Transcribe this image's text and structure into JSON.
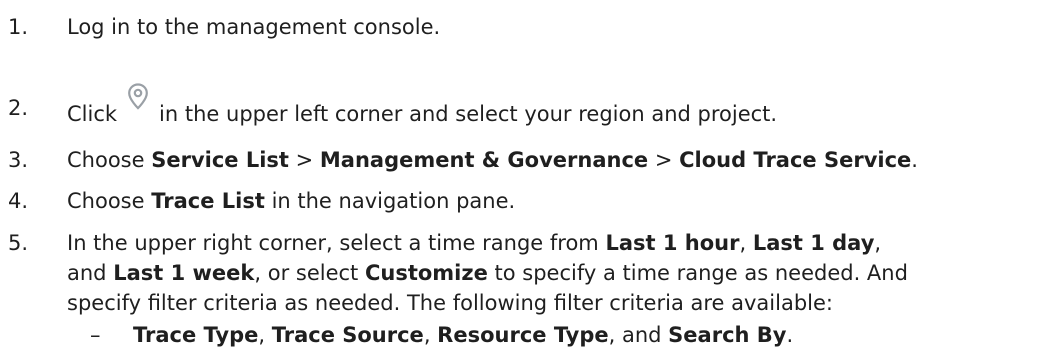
{
  "steps": [
    {
      "num": "1.",
      "text": "Log in to the management console."
    },
    {
      "num": "2.",
      "pre": "Click",
      "icon": "location-pin-icon",
      "post": "in the upper left corner and select your region and project."
    },
    {
      "num": "3.",
      "t1": "Choose ",
      "b1": "Service List",
      "t2": " > ",
      "b2": "Management & Governance",
      "t3": " > ",
      "b3": "Cloud Trace Service",
      "t4": "."
    },
    {
      "num": "4.",
      "t1": "Choose ",
      "b1": "Trace List",
      "t2": " in the navigation pane."
    },
    {
      "num": "5.",
      "t1": "In the upper right corner, select a time range from ",
      "b1": "Last 1 hour",
      "t2": ", ",
      "b2": "Last 1 day",
      "t3": ",",
      "t4": "and ",
      "b3": "Last 1 week",
      "t5": ", or select ",
      "b4": "Customize",
      "t6": " to specify a time range as needed. And",
      "t7": "specify filter criteria as needed. The following filter criteria are available:"
    }
  ],
  "sub_items": [
    {
      "dash": "–",
      "b1": "Trace Type",
      "t1": ", ",
      "b2": "Trace Source",
      "t2": ", ",
      "b3": "Resource Type",
      "t3": ", and ",
      "b4": "Search By",
      "t4": "."
    }
  ],
  "colors": {
    "text": "#1f1f1f",
    "icon": "#9aa0a6"
  }
}
